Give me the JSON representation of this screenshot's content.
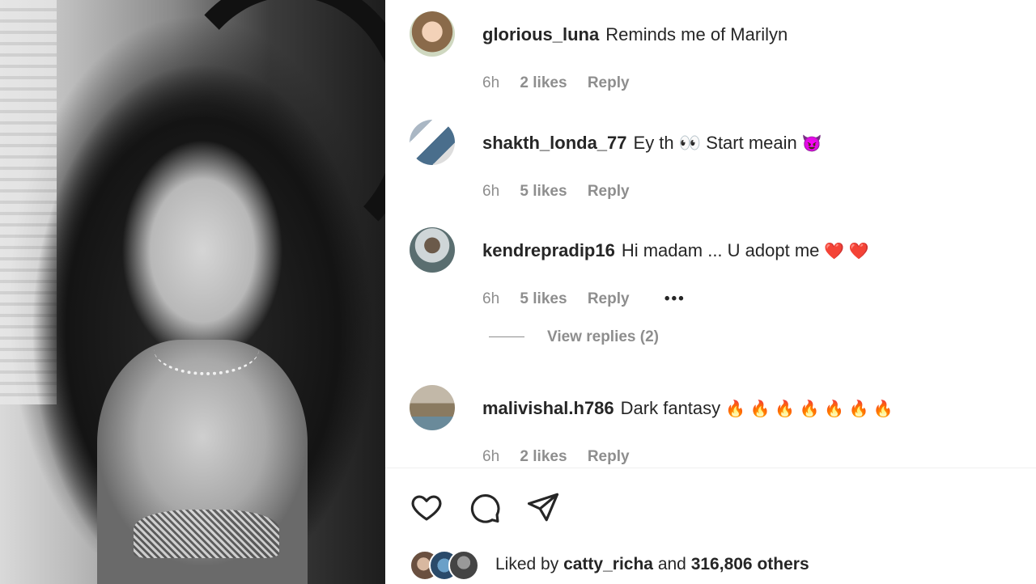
{
  "post_image": {
    "alt_icon": "photo"
  },
  "comments": [
    {
      "username": "glorious_luna",
      "text": "Reminds me of Marilyn",
      "emoji": "",
      "time": "6h",
      "likes": "2 likes",
      "reply": "Reply"
    },
    {
      "username": "shakth_londa_77",
      "text": "Ey th 👀 Start meain",
      "emoji": "😈",
      "time": "6h",
      "likes": "5 likes",
      "reply": "Reply"
    },
    {
      "username": "kendrepradip16",
      "text": "Hi madam ... U adopt me",
      "emoji": "❤️ ❤️",
      "time": "6h",
      "likes": "5 likes",
      "reply": "Reply",
      "more": "•••"
    },
    {
      "username": "malivishal.h786",
      "text": "Dark fantasy",
      "emoji": "🔥 🔥 🔥 🔥 🔥 🔥 🔥",
      "time": "6h",
      "likes": "2 likes",
      "reply": "Reply"
    }
  ],
  "view_replies": "View replies (2)",
  "actions": {
    "like_icon": "heart-icon",
    "comment_icon": "comment-icon",
    "share_icon": "share-icon"
  },
  "liked_by": {
    "prefix": "Liked by",
    "user": "catty_richa",
    "joiner": "and",
    "others": "316,806 others"
  }
}
